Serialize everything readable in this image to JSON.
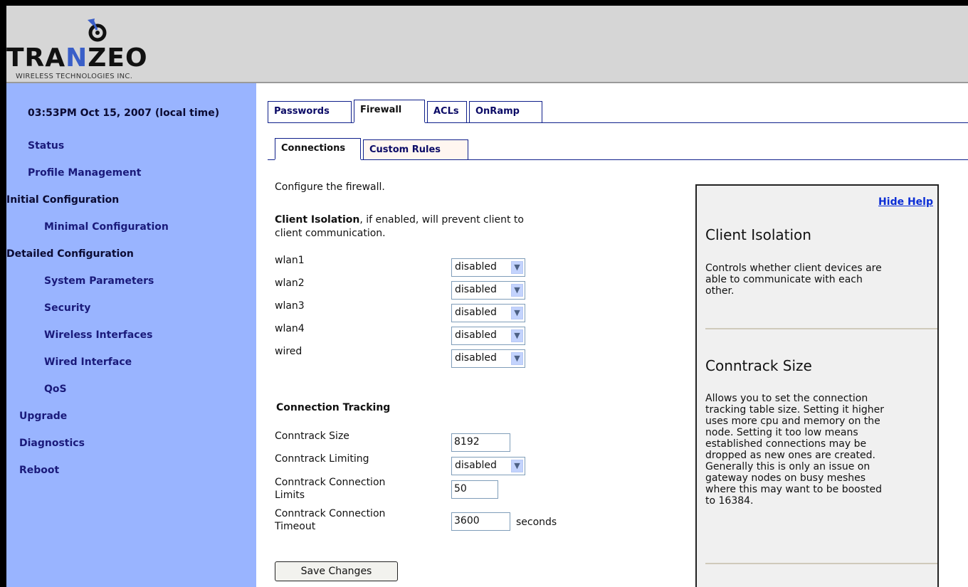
{
  "brand": {
    "name_left": "TRA",
    "name_n": "N",
    "name_right": "ZEO",
    "tagline": "WIRELESS TECHNOLOGIES INC."
  },
  "sidebar": {
    "clock": "03:53PM Oct 15, 2007 (local time)",
    "items": [
      {
        "label": "Status"
      },
      {
        "label": "Profile Management"
      },
      {
        "label": "Initial Configuration"
      },
      {
        "label": "Minimal Configuration"
      },
      {
        "label": "Detailed Configuration"
      },
      {
        "label": "System Parameters"
      },
      {
        "label": "Security"
      },
      {
        "label": "Wireless Interfaces"
      },
      {
        "label": "Wired Interface"
      },
      {
        "label": "QoS"
      },
      {
        "label": "Upgrade"
      },
      {
        "label": "Diagnostics"
      },
      {
        "label": "Reboot"
      }
    ]
  },
  "tabs": [
    {
      "label": "Passwords"
    },
    {
      "label": "Firewall"
    },
    {
      "label": "ACLs"
    },
    {
      "label": "OnRamp"
    }
  ],
  "subtabs": [
    {
      "label": "Connections"
    },
    {
      "label": "Custom Rules"
    }
  ],
  "main": {
    "intro": "Configure the firewall.",
    "isolation_title": "Client Isolation",
    "isolation_desc_1": ", if enabled, will prevent client to",
    "isolation_desc_2": "client communication.",
    "interfaces": [
      {
        "label": "wlan1",
        "value": "disabled"
      },
      {
        "label": "wlan2",
        "value": "disabled"
      },
      {
        "label": "wlan3",
        "value": "disabled"
      },
      {
        "label": "wlan4",
        "value": "disabled"
      },
      {
        "label": "wired",
        "value": "disabled"
      }
    ],
    "tracking_title": "Connection Tracking",
    "conntrack_size_label": "Conntrack Size",
    "conntrack_size_value": "8192",
    "conntrack_limiting_label": "Conntrack Limiting",
    "conntrack_limiting_value": "disabled",
    "conn_limits_label_1": "Conntrack Connection",
    "conn_limits_label_2": "Limits",
    "conn_limits_value": "50",
    "conn_timeout_label_1": "Conntrack Connection",
    "conn_timeout_label_2": "Timeout",
    "conn_timeout_value": "3600",
    "conn_timeout_unit": "seconds",
    "save_label": "Save Changes"
  },
  "help": {
    "hide_label": "Hide Help",
    "sections": [
      {
        "title": "Client Isolation",
        "lines": [
          "Controls whether client devices are",
          "able to communicate with each",
          "other."
        ]
      },
      {
        "title": "Conntrack Size",
        "lines": [
          "Allows you to set the connection",
          "tracking table size. Setting it higher",
          "uses more cpu and memory on the",
          "node. Setting it too low means",
          "established connections may be",
          "dropped as new ones are created.",
          "Generally this is only an issue on",
          "gateway nodes on busy meshes",
          "where this may want to be boosted",
          "to 16384."
        ]
      }
    ]
  }
}
